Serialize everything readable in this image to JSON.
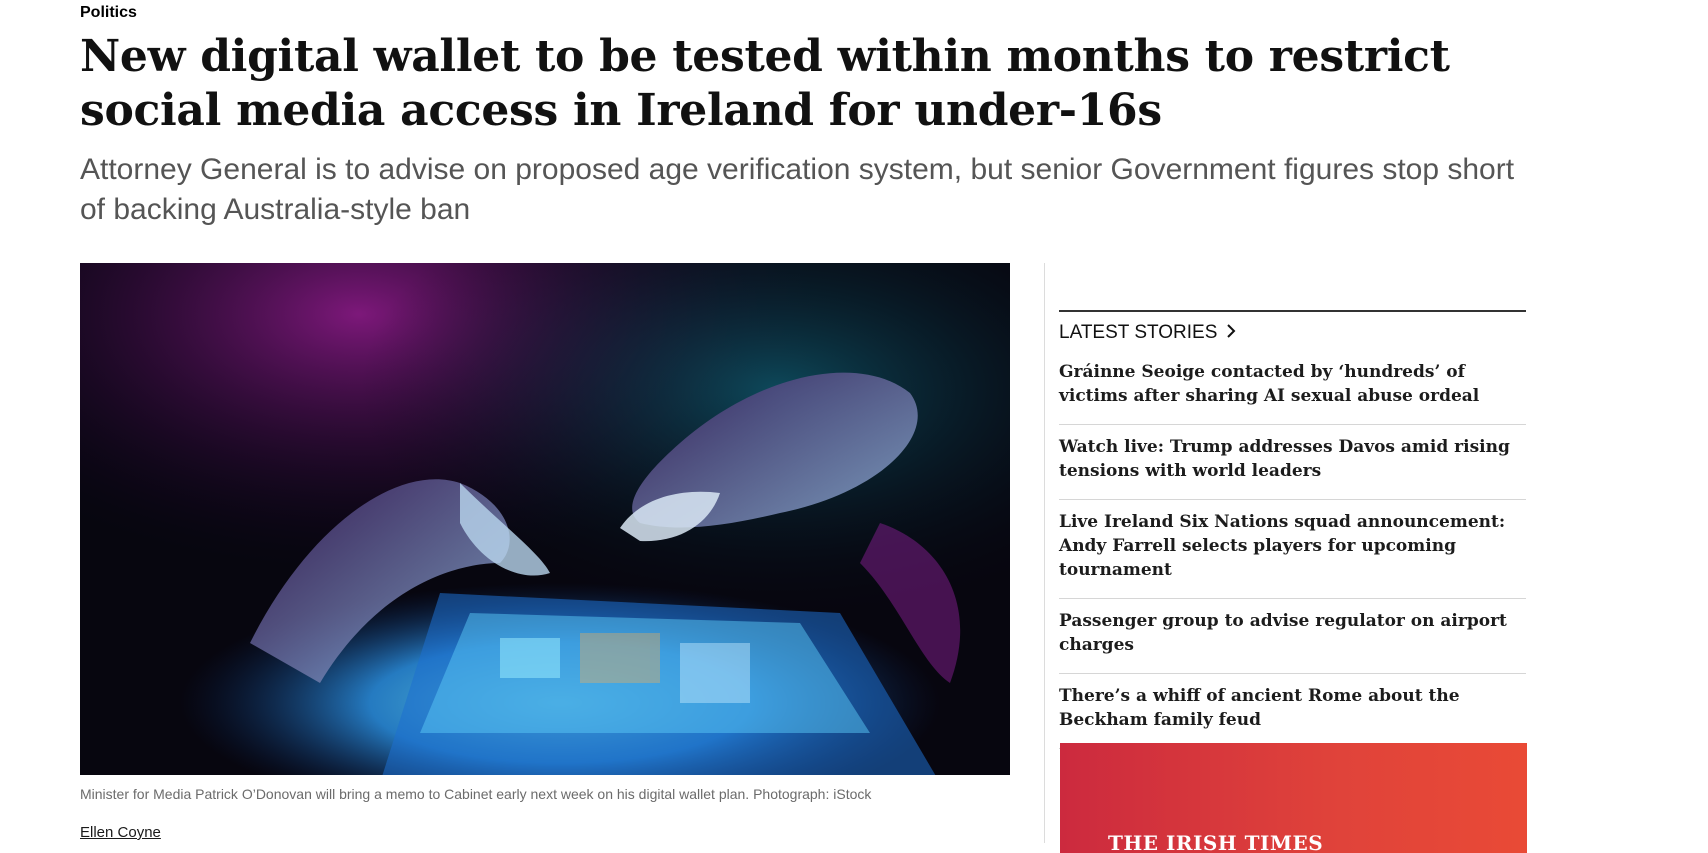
{
  "article": {
    "section": "Politics",
    "headline": "New digital wallet to be tested within months to restrict social media access in Ireland for under-16s",
    "standfirst": "Attorney General is to advise on proposed age verification system, but senior Government figures stop short of backing Australia-style ban",
    "image_caption": "Minister for Media Patrick O’Donovan will bring a memo to Cabinet early next week on his digital wallet plan. Photograph: iStock",
    "byline": "Ellen Coyne"
  },
  "sidebar": {
    "latest_heading": "LATEST STORIES",
    "heading_icon": "chevron-right-icon",
    "stories": [
      "Gráinne Seoige contacted by ‘hundreds’ of victims after sharing AI sexual abuse ordeal",
      "Watch live: Trump addresses Davos amid rising tensions with world leaders",
      "Live Ireland Six Nations squad announcement: Andy Farrell selects players for upcoming tournament",
      "Passenger group to advise regulator on airport charges",
      "There’s a whiff of ancient Rome about the Beckham family feud"
    ],
    "promo_brand": "THE IRISH TIMES"
  },
  "colors": {
    "promo_start": "#cc2a3e",
    "promo_end": "#e94a36",
    "standfirst": "#555555",
    "caption": "#6b6b6b"
  }
}
